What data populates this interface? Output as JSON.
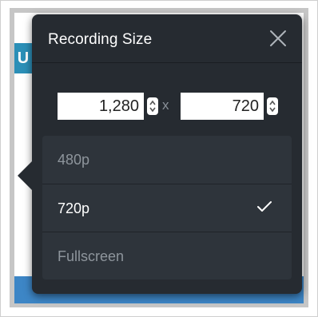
{
  "popup": {
    "title": "Recording Size",
    "close_icon": "close-x-icon"
  },
  "background": {
    "teal_letter": "U"
  },
  "size": {
    "width_value": "1,280",
    "height_value": "720",
    "separator": "x",
    "stepper_icon": "up-down-stepper-icon"
  },
  "options": [
    {
      "label": "480p",
      "selected": false
    },
    {
      "label": "720p",
      "selected": true
    },
    {
      "label": "Fullscreen",
      "selected": false
    }
  ],
  "check_icon": "checkmark-icon",
  "colors": {
    "popup_bg": "#262b31",
    "list_bg": "#2e343b",
    "teal": "#2b8fb7",
    "blue": "#3d86c6"
  }
}
